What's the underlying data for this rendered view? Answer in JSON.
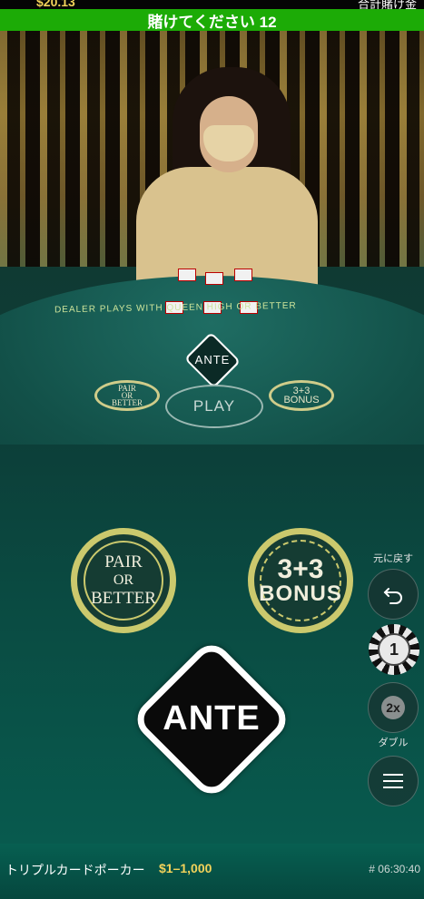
{
  "header": {
    "balance": "$20.13",
    "total_bet": "合計賭け金",
    "timer_text": "賭けてください 12"
  },
  "video": {
    "table_text": "DEALER PLAYS WITH QUEEN HIGH OR BETTER",
    "mini_ante": "ANTE",
    "mini_pair": [
      "PAIR",
      "OR",
      "BETTER"
    ],
    "mini_play": "PLAY",
    "mini_bonus": [
      "3+3",
      "BONUS"
    ]
  },
  "bets": {
    "pair_or_better": [
      "PAIR",
      "OR",
      "BETTER"
    ],
    "bonus": [
      "3+3",
      "BONUS"
    ],
    "ante": "ANTE"
  },
  "controls": {
    "undo_label": "元に戻す",
    "chip_value": "1",
    "double_icon_text": "2x",
    "double_label": "ダブル"
  },
  "footer": {
    "game_name": "トリプルカードポーカー",
    "limits": "$1–1,000",
    "game_id": "# 06:30:40"
  },
  "colors": {
    "timer_bg": "#1cab06",
    "accent_gold": "#cbc96d",
    "limits": "#f3d35a"
  }
}
